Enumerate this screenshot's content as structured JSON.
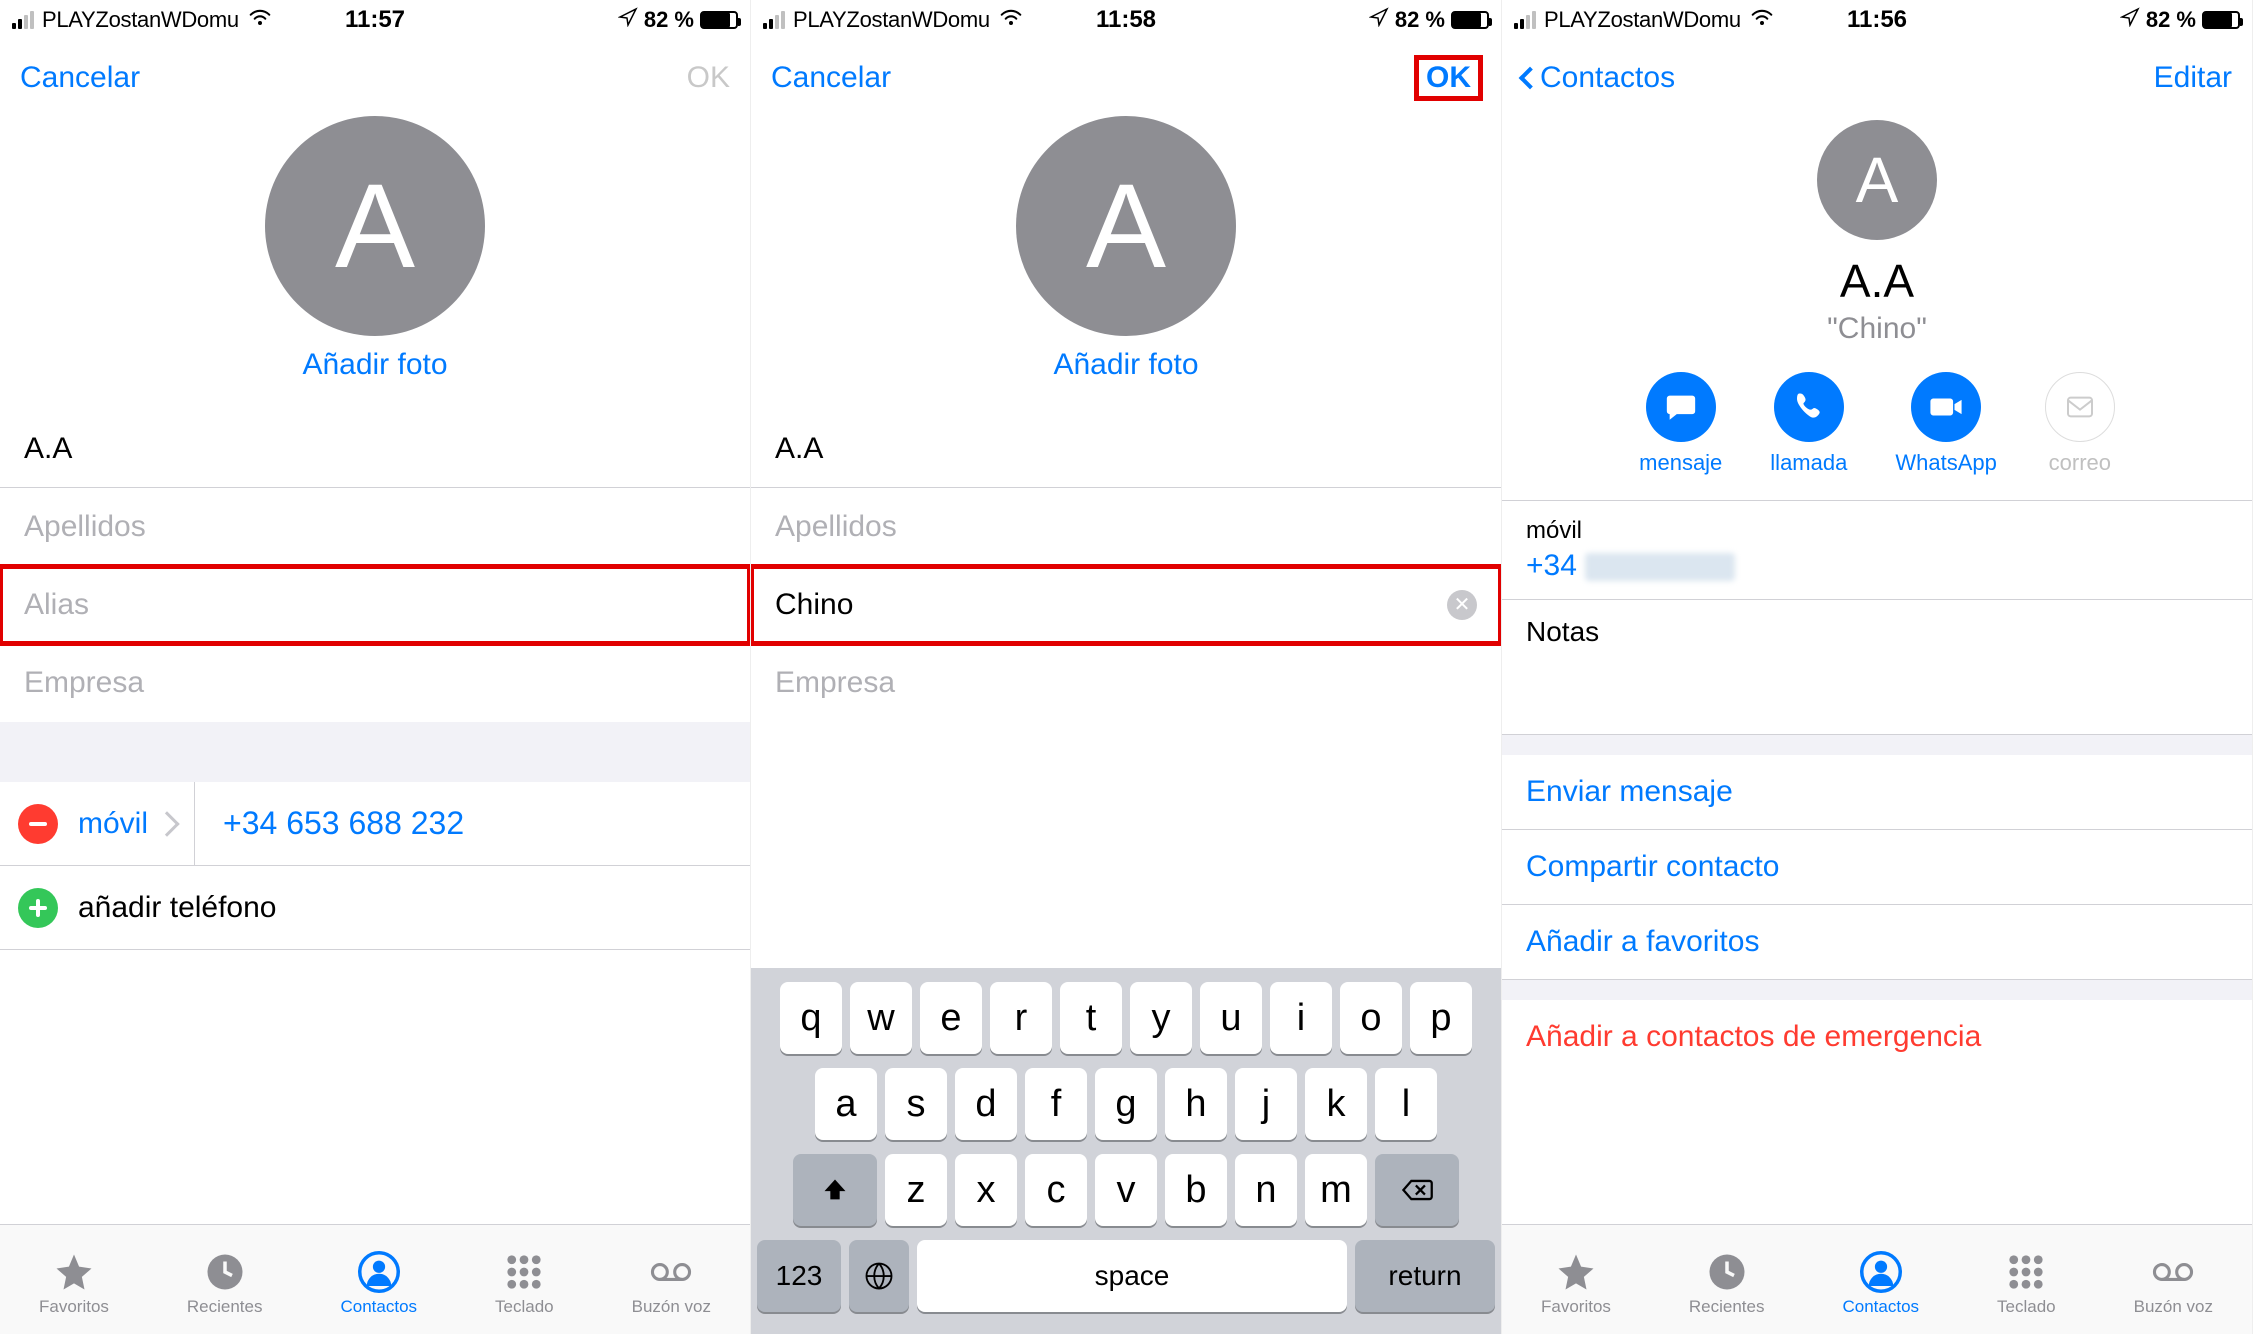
{
  "common": {
    "carrier": "PLAYZostanWDomu",
    "battery": "82 %",
    "avatar_letter": "A",
    "add_photo": "Añadir foto"
  },
  "pane1": {
    "time": "11:57",
    "nav_cancel": "Cancelar",
    "nav_ok": "OK",
    "name_value": "A.A",
    "lastname_placeholder": "Apellidos",
    "alias_placeholder": "Alias",
    "company_placeholder": "Empresa",
    "phone_type": "móvil",
    "phone_number": "+34 653 688 232",
    "add_phone": "añadir teléfono"
  },
  "pane2": {
    "time": "11:58",
    "nav_cancel": "Cancelar",
    "nav_ok": "OK",
    "name_value": "A.A",
    "lastname_placeholder": "Apellidos",
    "alias_value": "Chino",
    "company_placeholder": "Empresa",
    "keys_r1": [
      "q",
      "w",
      "e",
      "r",
      "t",
      "y",
      "u",
      "i",
      "o",
      "p"
    ],
    "keys_r2": [
      "a",
      "s",
      "d",
      "f",
      "g",
      "h",
      "j",
      "k",
      "l"
    ],
    "keys_r3": [
      "z",
      "x",
      "c",
      "v",
      "b",
      "n",
      "m"
    ],
    "num_key": "123",
    "space_key": "space",
    "return_key": "return"
  },
  "pane3": {
    "time": "11:56",
    "nav_back": "Contactos",
    "nav_edit": "Editar",
    "contact_name": "A.A",
    "nickname": "\"Chino\"",
    "actions": [
      {
        "label": "mensaje",
        "disabled": false
      },
      {
        "label": "llamada",
        "disabled": false
      },
      {
        "label": "WhatsApp",
        "disabled": false
      },
      {
        "label": "correo",
        "disabled": true
      }
    ],
    "phone_label": "móvil",
    "phone_prefix": "+34",
    "notes_label": "Notas",
    "link_send_msg": "Enviar mensaje",
    "link_share": "Compartir contacto",
    "link_fav": "Añadir a favoritos",
    "link_emergency": "Añadir a contactos de emergencia"
  },
  "tabs": [
    {
      "label": "Favoritos"
    },
    {
      "label": "Recientes"
    },
    {
      "label": "Contactos"
    },
    {
      "label": "Teclado"
    },
    {
      "label": "Buzón voz"
    }
  ]
}
